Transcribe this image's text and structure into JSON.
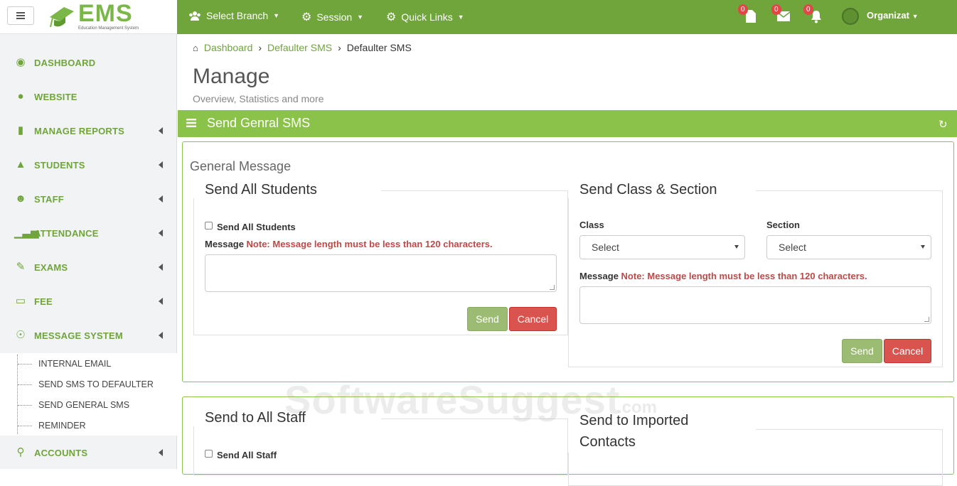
{
  "brand": {
    "logo_text": "EMS",
    "logo_sub": "Education Management System"
  },
  "topbar": {
    "select_branch": "Select Branch",
    "session": "Session",
    "quick_links": "Quick Links",
    "badge_docs": "0",
    "badge_mail": "0",
    "badge_bell": "0",
    "org": "Organizat"
  },
  "sidebar": {
    "items": [
      {
        "label": "DASHBOARD",
        "icon": "dashboard-icon"
      },
      {
        "label": "WEBSITE",
        "icon": "globe-icon"
      },
      {
        "label": "MANAGE REPORTS",
        "icon": "file-icon"
      },
      {
        "label": "STUDENTS",
        "icon": "graduation-cap-icon"
      },
      {
        "label": "STAFF",
        "icon": "users-icon"
      },
      {
        "label": "ATTENDANCE",
        "icon": "signal-icon"
      },
      {
        "label": "EXAMS",
        "icon": "edit-icon"
      },
      {
        "label": "FEE",
        "icon": "credit-card-icon"
      },
      {
        "label": "MESSAGE SYSTEM",
        "icon": "comments-icon"
      },
      {
        "label": "ACCOUNTS",
        "icon": "key-icon"
      }
    ],
    "submenu": [
      "INTERNAL EMAIL",
      "SEND SMS TO DEFAULTER",
      "SEND GENERAL SMS",
      "REMINDER"
    ]
  },
  "breadcrumb": {
    "home": "Dashboard",
    "mid": "Defaulter SMS",
    "current": "Defaulter SMS"
  },
  "page": {
    "title": "Manage",
    "subtitle": "Overview, Statistics and more"
  },
  "panel": {
    "title": "Send Genral SMS"
  },
  "general": {
    "heading": "General Message",
    "all_students": {
      "legend": "Send All Students",
      "checkbox": "Send All Students",
      "message_label": "Message",
      "note": "Note: Message length must be less than 120 characters.",
      "send": "Send",
      "cancel": "Cancel"
    },
    "class_section": {
      "legend": "Send Class & Section",
      "class_label": "Class",
      "section_label": "Section",
      "class_value": "Select",
      "section_value": "Select",
      "message_label": "Message",
      "note": "Note: Message length must be less than 120 characters.",
      "send": "Send",
      "cancel": "Cancel"
    }
  },
  "staff": {
    "legend": "Send to All Staff",
    "checkbox": "Send All Staff",
    "imported_legend_1": "Send to Imported",
    "imported_legend_2": "Contacts"
  },
  "watermark": {
    "text": "SoftwareSuggest",
    "suffix": ".com"
  },
  "colors": {
    "primary": "#6fa53b",
    "panel": "#8bc34a",
    "danger": "#d9534f"
  }
}
